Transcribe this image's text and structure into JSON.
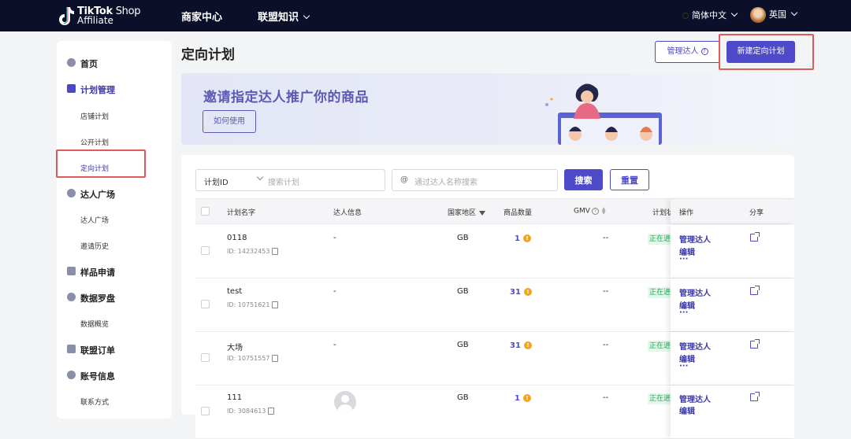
{
  "topbar": {
    "logo_line1": "TikTok",
    "logo_line1b": " Shop",
    "logo_line2": "Affiliate",
    "nav_merchant": "商家中心",
    "nav_knowledge": "联盟知识",
    "language": "简体中文",
    "country": "英国"
  },
  "sidebar": {
    "home": "首页",
    "plan_manage": "计划管理",
    "shop_plan": "店铺计划",
    "public_plan": "公开计划",
    "targeted_plan": "定向计划",
    "creator_square": "达人广场",
    "creator_square_sub": "达人广场",
    "invite_history": "邀请历史",
    "sample_request": "样品申请",
    "data_compass": "数据罗盘",
    "data_overview": "数据概览",
    "affiliate_orders": "联盟订单",
    "account_info": "账号信息",
    "contact": "联系方式"
  },
  "page": {
    "title": "定向计划",
    "manage_creators": "管理达人",
    "new_plan": "新建定向计划"
  },
  "banner": {
    "title": "邀请指定达人推广你的商品",
    "how_to": "如何使用"
  },
  "filters": {
    "select_value": "计划ID",
    "select_placeholder": "搜索计划",
    "at_symbol": "@",
    "creator_placeholder": "通过达人名称搜索",
    "search": "搜索",
    "reset": "重置"
  },
  "table": {
    "headers": {
      "name": "计划名字",
      "creator": "达人信息",
      "region": "国家地区",
      "products": "商品数量",
      "gmv": "GMV",
      "status": "计划状",
      "actions": "操作",
      "share": "分享"
    },
    "rows": [
      {
        "name": "0118",
        "id": "ID: 14232453",
        "creator": "-",
        "region": "GB",
        "products": "1",
        "gmv": "--",
        "status": "正在进行",
        "manage": "管理达人",
        "edit": "编辑",
        "more": "···"
      },
      {
        "name": "test",
        "id": "ID: 10751621",
        "creator": "-",
        "region": "GB",
        "products": "31",
        "gmv": "--",
        "status": "正在进行",
        "manage": "管理达人",
        "edit": "编辑",
        "more": "···"
      },
      {
        "name": "大场",
        "id": "ID: 10751557",
        "creator": "-",
        "region": "GB",
        "products": "31",
        "gmv": "--",
        "status": "正在进行",
        "manage": "管理达人",
        "edit": "编辑",
        "more": "···"
      },
      {
        "name": "111",
        "id": "ID: 3084613",
        "creator": "",
        "region": "GB",
        "products": "1",
        "gmv": "--",
        "status": "正在进行",
        "manage": "管理达人",
        "edit": "编辑",
        "more": "···"
      }
    ]
  },
  "colors": {
    "brand": "#4e4ac9",
    "topbar": "#0c0f2a",
    "highlight": "#e35959",
    "warning": "#f2a41a"
  }
}
